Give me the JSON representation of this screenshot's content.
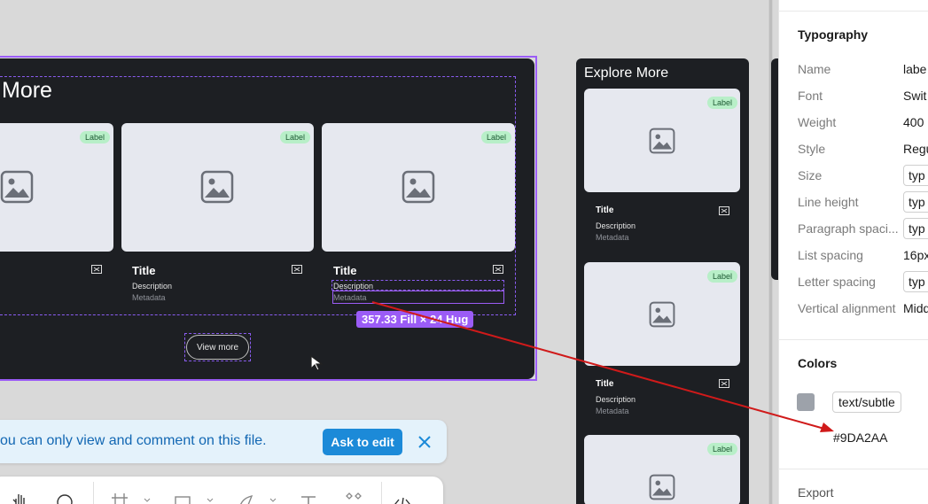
{
  "canvas": {
    "main_frame": {
      "heading": "More",
      "cards": [
        {
          "badge": "Label",
          "title": "",
          "description": "",
          "metadata": ""
        },
        {
          "badge": "Label",
          "title": "Title",
          "description": "Description",
          "metadata": "Metadata"
        },
        {
          "badge": "Label",
          "title": "Title",
          "description": "Description",
          "metadata": "Metadata"
        }
      ],
      "view_more": "View more",
      "dimension_label": "357.33 Fill × 24 Hug"
    },
    "side_frame": {
      "heading": "Explore More",
      "cards": [
        {
          "badge": "Label",
          "title": "Title",
          "description": "Description",
          "metadata": "Metadata"
        },
        {
          "badge": "Label",
          "title": "Title",
          "description": "Description",
          "metadata": "Metadata"
        },
        {
          "badge": "Label"
        }
      ]
    }
  },
  "banner": {
    "text": "ou can only view and comment on this file.",
    "ask_button": "Ask to edit"
  },
  "toolbar": {
    "icons": [
      "hand-icon",
      "comment-icon",
      "frame-icon",
      "rectangle-icon",
      "pen-icon",
      "text-icon",
      "components-icon",
      "dev-mode-icon"
    ]
  },
  "panel": {
    "typography": {
      "title": "Typography",
      "rows": [
        {
          "label": "Name",
          "value": "labe"
        },
        {
          "label": "Font",
          "value": "Swit"
        },
        {
          "label": "Weight",
          "value": "400"
        },
        {
          "label": "Style",
          "value": "Regu"
        },
        {
          "label": "Size",
          "value": "typ"
        },
        {
          "label": "Line height",
          "value": "typ"
        },
        {
          "label": "Paragraph spaci...",
          "value": "typ"
        },
        {
          "label": "List spacing",
          "value": "16px"
        },
        {
          "label": "Letter spacing",
          "value": "typ"
        },
        {
          "label": "Vertical alignment",
          "value": "Midd"
        }
      ]
    },
    "colors": {
      "title": "Colors",
      "token": "text/subtle",
      "hex": "#9DA2AA"
    },
    "export": {
      "title": "Export"
    }
  },
  "colors": {
    "selection": "#9b5cf6",
    "dark_frame": "#1d1f23",
    "badge": "#b8efc8",
    "ask_button": "#1c8ad8",
    "annotation_arrow": "#d01a1a"
  }
}
